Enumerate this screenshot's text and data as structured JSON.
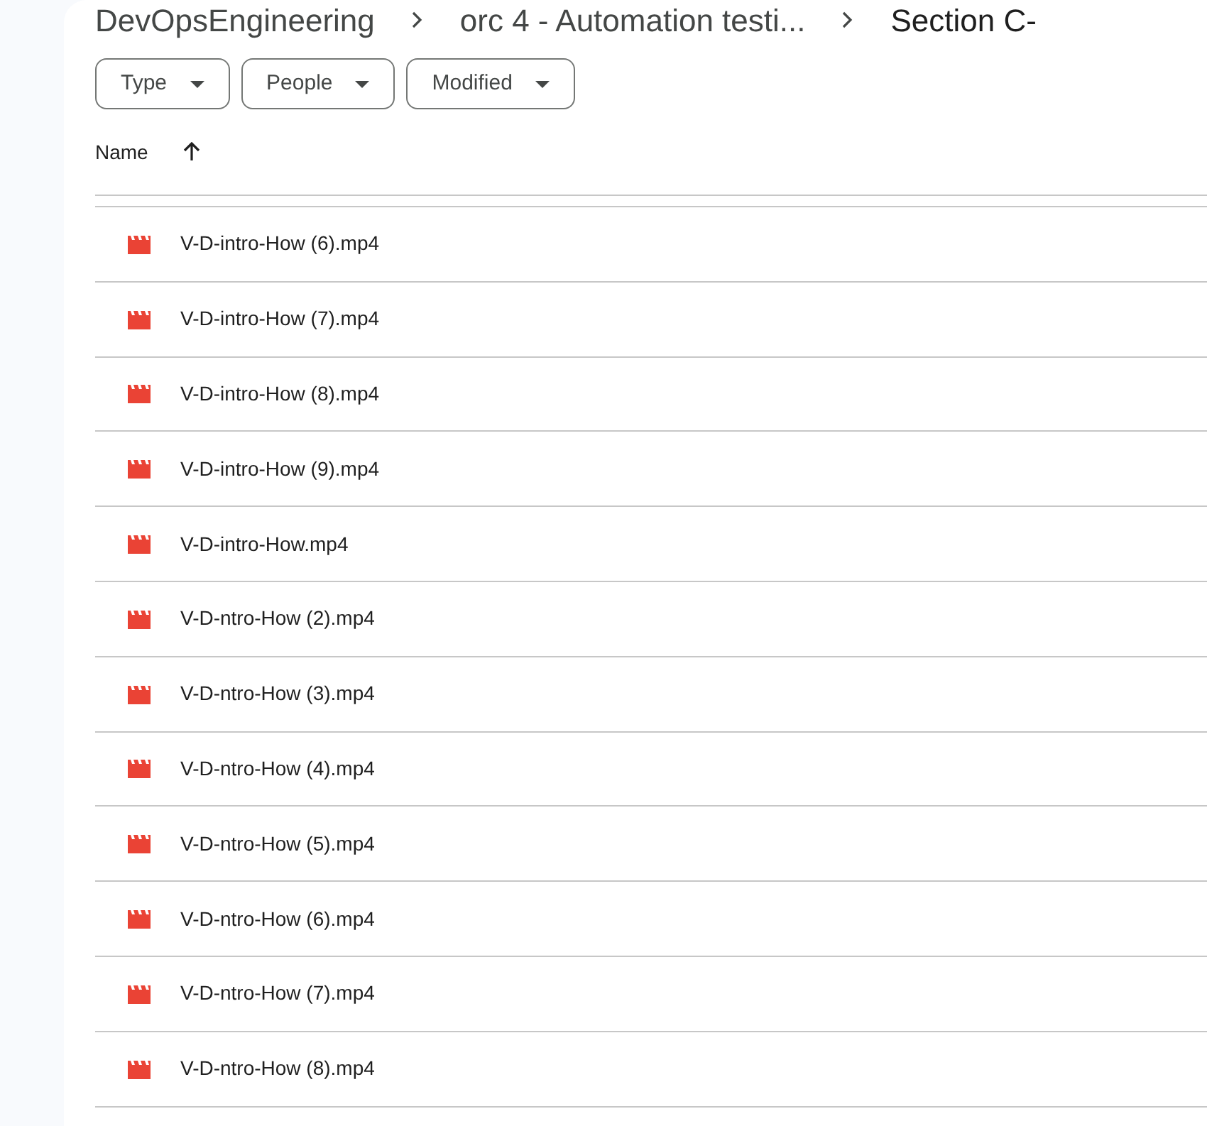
{
  "breadcrumb": [
    "DevOpsEngineering",
    "orc 4 - Automation testi...",
    "Section C-"
  ],
  "filters": [
    "Type",
    "People",
    "Modified"
  ],
  "table": {
    "columns": [
      {
        "label": "Name",
        "sort_ascending": true
      }
    ],
    "rows": [
      {
        "name": "V-D-intro-How (6).mp4"
      },
      {
        "name": "V-D-intro-How (7).mp4"
      },
      {
        "name": "V-D-intro-How (8).mp4"
      },
      {
        "name": "V-D-intro-How (9).mp4"
      },
      {
        "name": "V-D-intro-How.mp4"
      },
      {
        "name": "V-D-ntro-How (2).mp4"
      },
      {
        "name": "V-D-ntro-How (3).mp4"
      },
      {
        "name": "V-D-ntro-How (4).mp4"
      },
      {
        "name": "V-D-ntro-How (5).mp4"
      },
      {
        "name": "V-D-ntro-How (6).mp4"
      },
      {
        "name": "V-D-ntro-How (7).mp4"
      },
      {
        "name": "V-D-ntro-How (8).mp4"
      }
    ]
  }
}
